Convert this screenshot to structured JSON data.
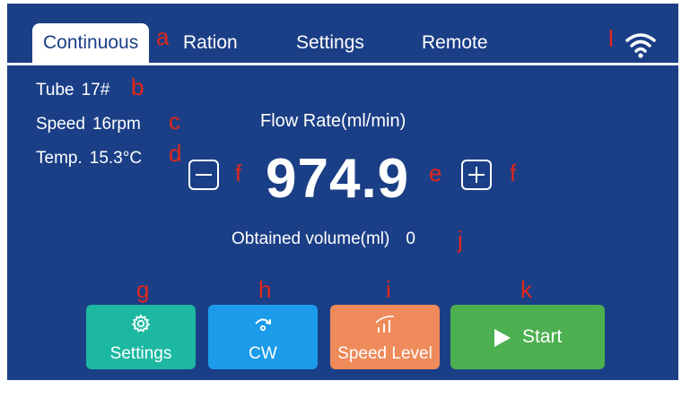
{
  "tabs": [
    {
      "label": "Continuous",
      "active": true
    },
    {
      "label": "Ration",
      "active": false
    },
    {
      "label": "Settings",
      "active": false
    },
    {
      "label": "Remote",
      "active": false
    }
  ],
  "status": {
    "tube_label": "Tube",
    "tube_value": "17#",
    "speed_label": "Speed",
    "speed_value": "16rpm",
    "temp_label": "Temp.",
    "temp_value": "15.3°C"
  },
  "flow": {
    "label": "Flow Rate(ml/min)",
    "value": "974.9"
  },
  "obtained": {
    "label": "Obtained volume(ml)",
    "value": "0"
  },
  "buttons": {
    "settings": {
      "label": "Settings",
      "icon": "gear-icon",
      "color": "#1cb8a2"
    },
    "direction": {
      "label": "CW",
      "icon": "rotate-cw-icon",
      "color": "#1b9bea"
    },
    "speed_level": {
      "label": "Speed Level",
      "icon": "signal-bars-icon",
      "color": "#ef8a5a"
    },
    "start": {
      "label": "Start",
      "icon": "play-icon",
      "color": "#4caf50"
    }
  },
  "annotations": {
    "a": "a",
    "b": "b",
    "c": "c",
    "d": "d",
    "e": "e",
    "f1": "f",
    "f2": "f",
    "g": "g",
    "h": "h",
    "i": "i",
    "j": "j",
    "k": "k",
    "l": "l"
  },
  "colors": {
    "screen_bg": "#1b3f86",
    "annotation": "#e1271a"
  }
}
